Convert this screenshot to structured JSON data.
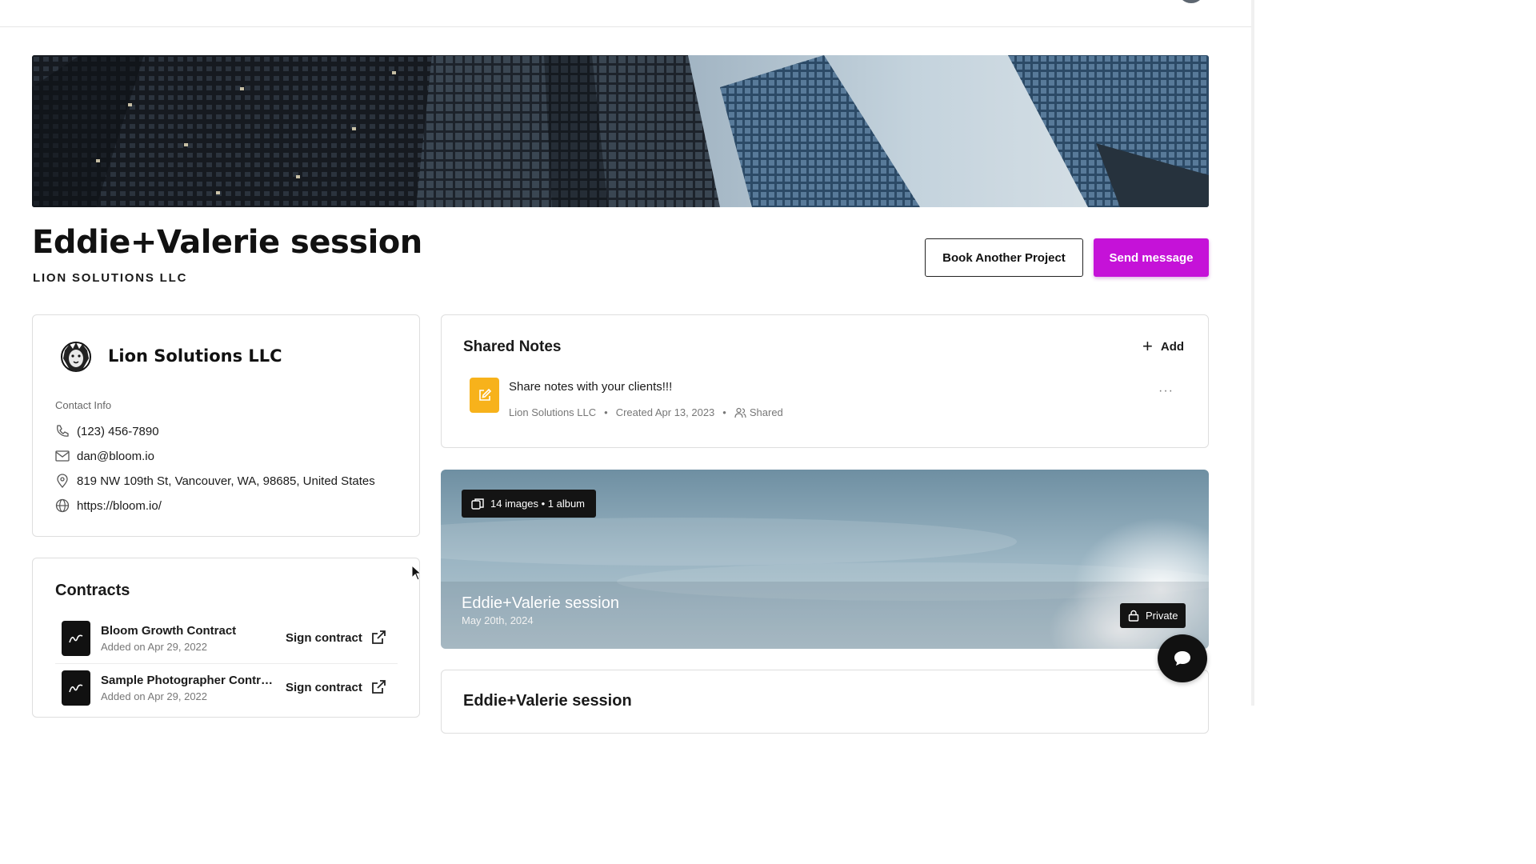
{
  "header": {
    "avatar_icon": "user-avatar"
  },
  "project": {
    "title": "Eddie+Valerie session",
    "subtitle": "LION SOLUTIONS LLC",
    "book_button": "Book Another Project",
    "message_button": "Send message"
  },
  "colors": {
    "primary": "#c512d8",
    "note_accent": "#f7b21b",
    "dark": "#111111"
  },
  "contact": {
    "company_name": "Lion Solutions LLC",
    "logo_icon": "lion-head-icon",
    "label": "Contact Info",
    "phone": "(123) 456-7890",
    "email": "dan@bloom.io",
    "address": "819 NW 109th St, Vancouver, WA, 98685, United States",
    "website": "https://bloom.io/"
  },
  "contracts": {
    "title": "Contracts",
    "items": [
      {
        "name": "Bloom Growth Contract",
        "added": "Added on Apr 29, 2022",
        "action": "Sign contract"
      },
      {
        "name": "Sample Photographer Contract",
        "added": "Added on Apr 29, 2022",
        "action": "Sign contract"
      }
    ]
  },
  "notes": {
    "title": "Shared Notes",
    "add_label": "Add",
    "items": [
      {
        "text": "Share notes with your clients!!!",
        "author": "Lion Solutions LLC",
        "created": "Created Apr 13, 2023",
        "visibility": "Shared",
        "menu": "···"
      }
    ]
  },
  "galleries": [
    {
      "badge": "14 images • 1 album",
      "title": "Eddie+Valerie session",
      "date": "May 20th, 2024",
      "privacy": "Private"
    },
    {
      "title": "Eddie+Valerie session"
    }
  ],
  "chat": {
    "icon": "chat-bubble-icon"
  }
}
